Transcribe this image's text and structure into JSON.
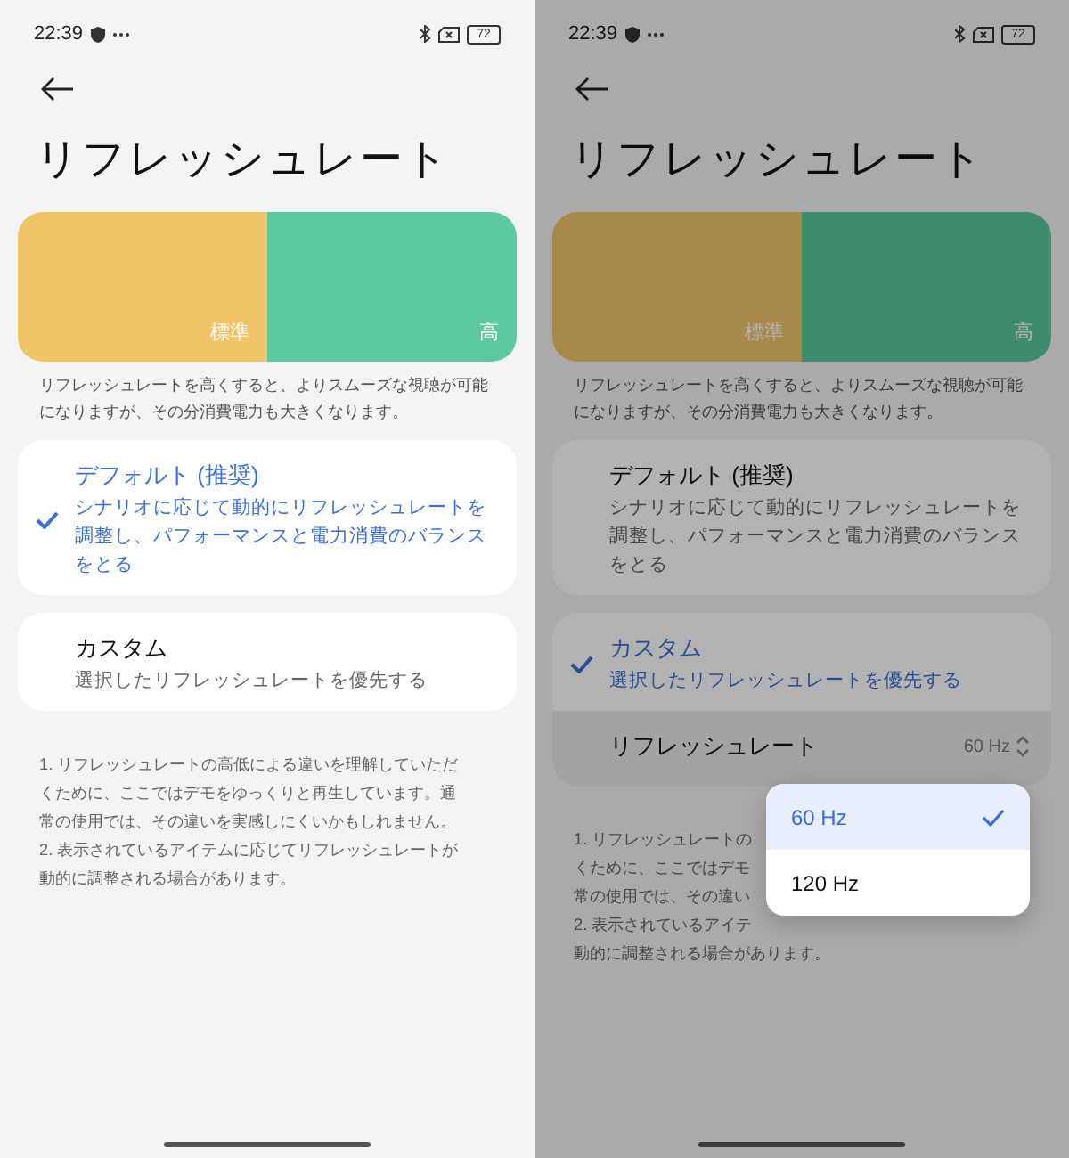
{
  "screens": [
    {
      "status_bar": {
        "time": "22:39",
        "battery": "72"
      },
      "title": "リフレッシュレート",
      "preview": {
        "segments": [
          {
            "label": "標準"
          },
          {
            "label": "高"
          }
        ]
      },
      "description": "リフレッシュレートを高くすると、よりスムーズな視聴が可能になりますが、その分消費電力も大きくなります。",
      "options": [
        {
          "title": "デフォルト (推奨)",
          "subtitle": "シナリオに応じて動的にリフレッシュレートを調整し、パフォーマンスと電力消費のバランスをとる",
          "selected": true
        },
        {
          "title": "カスタム",
          "subtitle": "選択したリフレッシュレートを優先する",
          "selected": false
        }
      ],
      "notes": [
        "1. リフレッシュレートの高低による違いを理解していただ",
        "くために、ここではデモをゆっくりと再生しています。通",
        "常の使用では、その違いを実感しにくいかもしれません。",
        "2. 表示されているアイテムに応じてリフレッシュレートが",
        "動的に調整される場合があります。"
      ]
    },
    {
      "dimmed": true,
      "status_bar": {
        "time": "22:39",
        "battery": "72"
      },
      "title": "リフレッシュレート",
      "preview": {
        "segments": [
          {
            "label": "標準"
          },
          {
            "label": "高"
          }
        ]
      },
      "description": "リフレッシュレートを高くすると、よりスムーズな視聴が可能になりますが、その分消費電力も大きくなります。",
      "options": [
        {
          "title": "デフォルト (推奨)",
          "subtitle": "シナリオに応じて動的にリフレッシュレートを調整し、パフォーマンスと電力消費のバランスをとる",
          "selected": false
        },
        {
          "title": "カスタム",
          "subtitle": "選択したリフレッシュレートを優先する",
          "selected": true,
          "setting": {
            "label": "リフレッシュレート",
            "value": "60 Hz"
          }
        }
      ],
      "notes": [
        "1. リフレッシュレートの",
        "くために、ここではデモ",
        "常の使用では、その違い",
        "2. 表示されているアイテ",
        "動的に調整される場合があります。"
      ],
      "menu": [
        {
          "label": "60 Hz",
          "selected": true
        },
        {
          "label": "120 Hz",
          "selected": false
        }
      ]
    }
  ]
}
